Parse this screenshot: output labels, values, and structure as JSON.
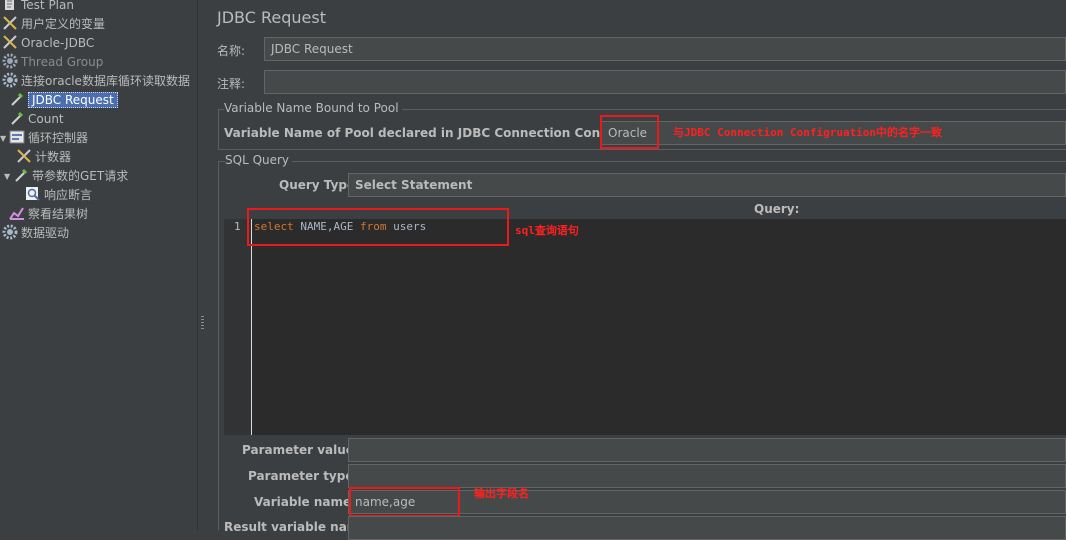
{
  "tree": {
    "items": [
      {
        "label": "Test Plan",
        "icon": "test-plan-icon"
      },
      {
        "label": "用户定义的变量",
        "icon": "wrench-icon"
      },
      {
        "label": "Oracle-JDBC",
        "icon": "wrench-icon"
      },
      {
        "label": "Thread Group",
        "icon": "gear-icon"
      },
      {
        "label": "连接oracle数据库循环读取数据",
        "icon": "gear-icon"
      },
      {
        "label": "JDBC Request",
        "icon": "dropper-icon"
      },
      {
        "label": "Count",
        "icon": "dropper-icon"
      },
      {
        "label": "循环控制器",
        "icon": "controller-icon"
      },
      {
        "label": "计数器",
        "icon": "wrench-icon"
      },
      {
        "label": "带参数的GET请求",
        "icon": "dropper-icon"
      },
      {
        "label": "响应断言",
        "icon": "magnifier-icon"
      },
      {
        "label": "察看结果树",
        "icon": "chart-icon"
      },
      {
        "label": "数据驱动",
        "icon": "gear-icon"
      }
    ]
  },
  "panel": {
    "title": "JDBC Request",
    "name_label": "名称:",
    "name_value": "JDBC Request",
    "comment_label": "注释:",
    "comment_value": "",
    "pool_group_title": "Variable Name Bound to Pool",
    "pool_label": "Variable Name of Pool declared in JDBC Connection Configuration:",
    "pool_value": "Oracle",
    "pool_note": "与JDBC Connection Configruation中的名字一致",
    "sql_group_title": "SQL Query",
    "query_type_label": "Query Type:",
    "query_type_value": "Select Statement",
    "query_header": "Query:",
    "line_number": "1",
    "sql_keyword_select": "select",
    "sql_columns": " NAME,AGE ",
    "sql_keyword_from": "from",
    "sql_table": " users",
    "sql_note": "sql查询语句",
    "param_values_label": "Parameter values:",
    "param_values_value": "",
    "param_types_label": "Parameter types:",
    "param_types_value": "",
    "var_names_label": "Variable names:",
    "var_names_value": "name,age",
    "var_names_note": "输出字段名",
    "result_var_label": "Result variable name:"
  },
  "colors": {
    "accent_selected": "#4b6eaf",
    "annotation_red": "#e81a1a",
    "sql_keyword": "#cc7832"
  }
}
